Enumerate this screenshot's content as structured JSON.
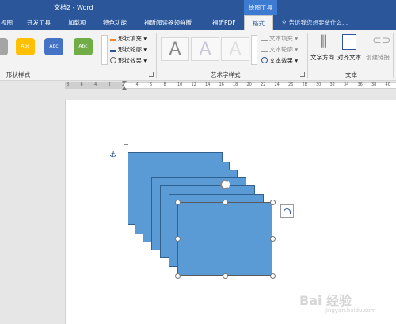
{
  "titlebar": {
    "title": "文档2 - Word",
    "context_tab": "绘图工具"
  },
  "tabs": [
    {
      "label": "视图"
    },
    {
      "label": "开发工具"
    },
    {
      "label": "加载项"
    },
    {
      "label": "特色功能"
    },
    {
      "label": "福昕阅读器领鲜版"
    },
    {
      "label": "福昕PDF"
    },
    {
      "label": "格式"
    }
  ],
  "tellme": "告诉我您想要做什么...",
  "ribbon": {
    "shape_styles": {
      "swatches": [
        {
          "label": "Abc",
          "color": "#ffc000"
        },
        {
          "label": "Abc",
          "color": "#4472c4"
        },
        {
          "label": "Abc",
          "color": "#70ad47"
        }
      ],
      "fill": "形状填充",
      "outline": "形状轮廓",
      "effects": "形状效果",
      "group_label": "形状样式"
    },
    "wordart": {
      "letters": [
        "A",
        "A",
        "A"
      ],
      "text_fill": "文本填充",
      "text_outline": "文本轮廓",
      "text_effects": "文本效果",
      "group_label": "艺术字样式"
    },
    "text": {
      "direction": "文字方向",
      "align": "对齐文本",
      "link": "创建链接",
      "group_label": "文本"
    }
  },
  "ruler": {
    "numbers": [
      "8",
      "6",
      "4",
      "2",
      "2",
      "4",
      "6",
      "8",
      "10",
      "12",
      "14",
      "16",
      "18",
      "20",
      "22",
      "24",
      "26",
      "28",
      "30",
      "32",
      "34",
      "36",
      "38",
      "40"
    ]
  },
  "watermark": {
    "text": "Bai 经验",
    "sub": "jingyan.baidu.com"
  },
  "colors": {
    "accent": "#2b579a",
    "shape_fill": "#5b9bd5"
  }
}
